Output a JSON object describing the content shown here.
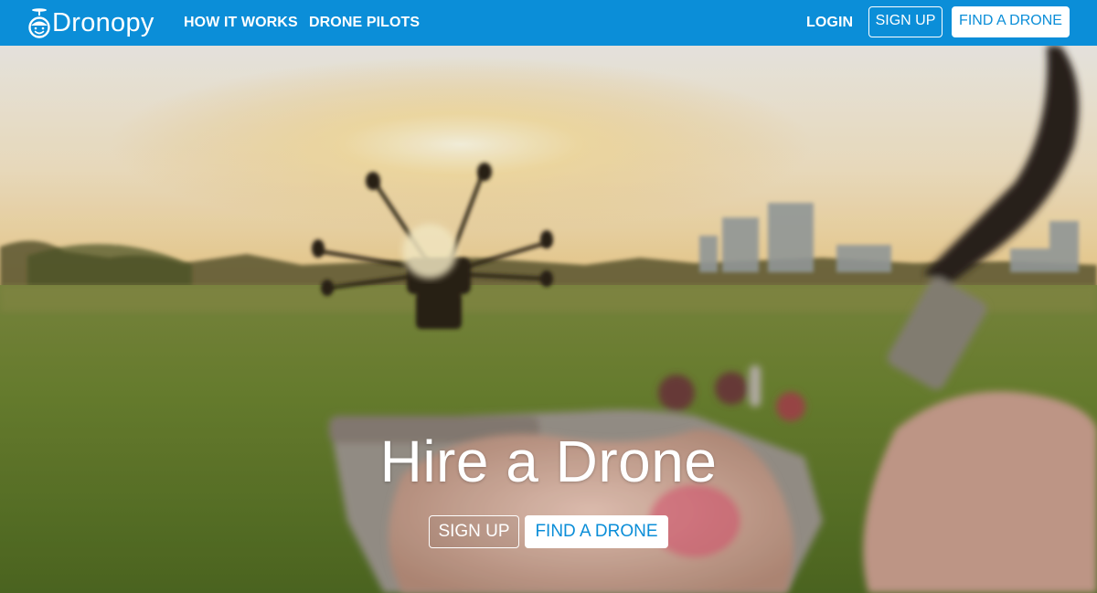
{
  "brand": {
    "name": "Dronopy"
  },
  "nav": {
    "how_it_works": "HOW IT WORKS",
    "drone_pilots": "DRONE PILOTS",
    "login": "LOGIN",
    "sign_up": "SIGN UP",
    "find_a_drone": "FIND A DRONE"
  },
  "hero": {
    "title": "Hire a Drone",
    "sign_up": "SIGN UP",
    "find_a_drone": "FIND A DRONE"
  },
  "colors": {
    "brand_blue": "#0b8ed8",
    "white": "#ffffff"
  },
  "icons": {
    "logo": "drone-head-icon"
  }
}
